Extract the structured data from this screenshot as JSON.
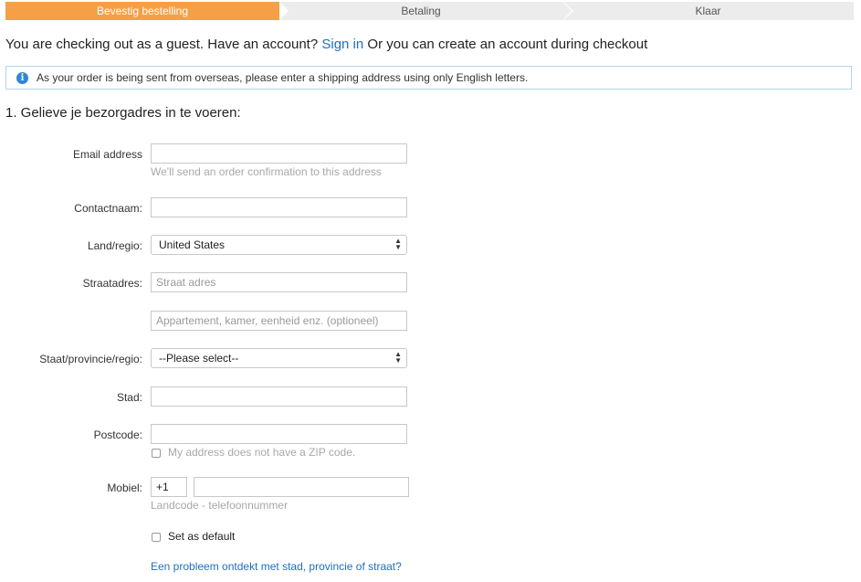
{
  "steps": [
    "Bevestig bestelling",
    "Betaling",
    "Klaar"
  ],
  "guest": {
    "prefix": "You are checking out as a guest. Have an account?",
    "sign_in": "Sign in",
    "suffix": "Or you can create an account during checkout"
  },
  "info": {
    "icon": "info-icon",
    "icon_glyph": "i",
    "text": "As your order is being sent from overseas, please enter a shipping address using only English letters."
  },
  "section_title": "1. Gelieve je bezorgadres in te voeren:",
  "form": {
    "email_label": "Email address",
    "email_value": "",
    "email_hint": "We'll send an order confirmation to this address",
    "contact_label": "Contactnaam:",
    "contact_value": "",
    "country_label": "Land/regio:",
    "country_value": "United States",
    "street_label": "Straatadres:",
    "street_placeholder": "Straat adres",
    "street2_placeholder": "Appartement, kamer, eenheid enz. (optioneel)",
    "state_label": "Staat/provincie/regio:",
    "state_value": "--Please select--",
    "city_label": "Stad:",
    "city_value": "",
    "zip_label": "Postcode:",
    "zip_value": "",
    "no_zip_label": "My address does not have a ZIP code.",
    "mobile_label": "Mobiel:",
    "country_code": "+1",
    "phone_value": "",
    "phone_hint": "Landcode - telefoonnummer",
    "default_label": "Set as default",
    "problem_link": "Een probleem ontdekt met stad, provincie of straat?"
  },
  "colors": {
    "active_step": "#f5a047",
    "inactive_step": "#ececec",
    "link": "#1f6fbf",
    "info_border": "#b3d4f2",
    "info_icon": "#2f86d6"
  }
}
